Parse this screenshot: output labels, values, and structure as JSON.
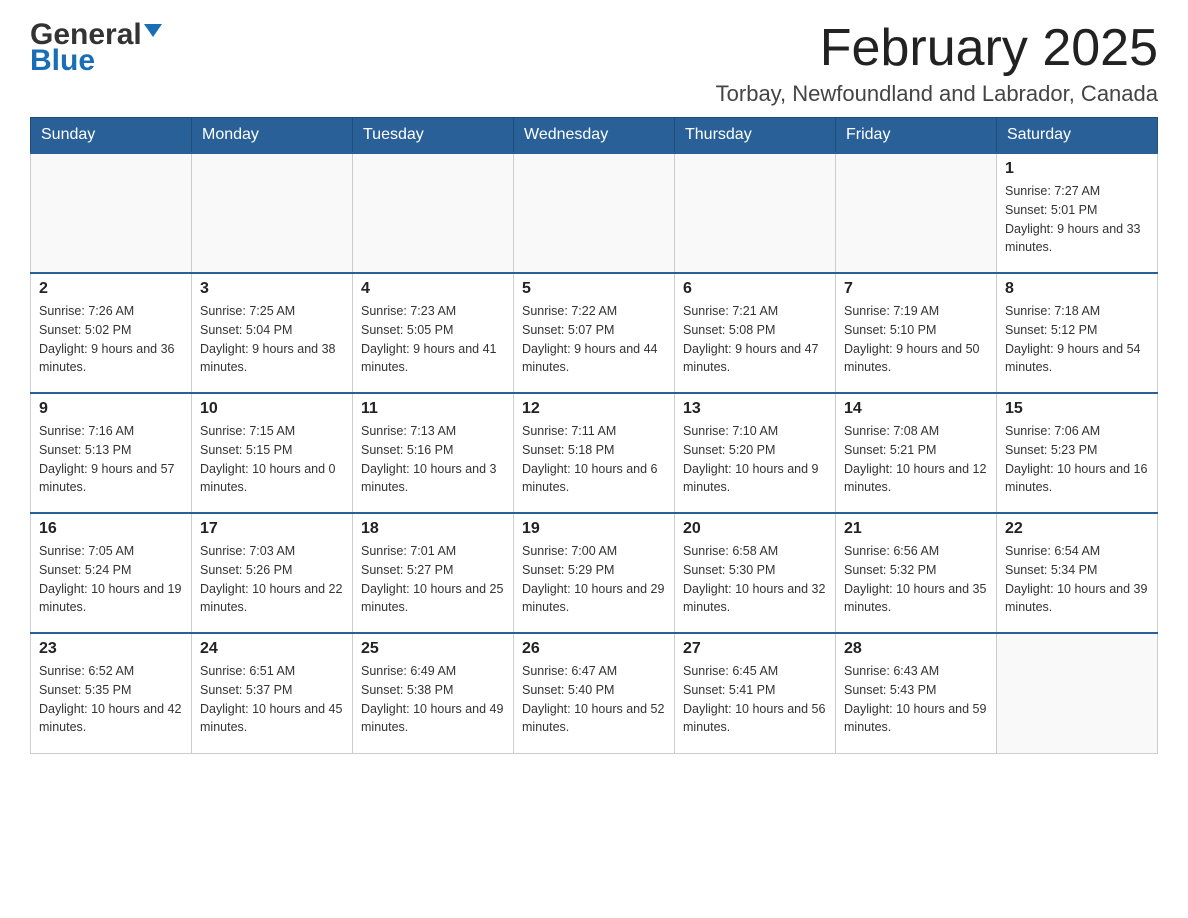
{
  "header": {
    "logo_general": "General",
    "logo_blue": "Blue",
    "month_year": "February 2025",
    "location": "Torbay, Newfoundland and Labrador, Canada"
  },
  "days_of_week": [
    "Sunday",
    "Monday",
    "Tuesday",
    "Wednesday",
    "Thursday",
    "Friday",
    "Saturday"
  ],
  "weeks": [
    {
      "days": [
        {
          "num": "",
          "info": ""
        },
        {
          "num": "",
          "info": ""
        },
        {
          "num": "",
          "info": ""
        },
        {
          "num": "",
          "info": ""
        },
        {
          "num": "",
          "info": ""
        },
        {
          "num": "",
          "info": ""
        },
        {
          "num": "1",
          "info": "Sunrise: 7:27 AM\nSunset: 5:01 PM\nDaylight: 9 hours and 33 minutes."
        }
      ]
    },
    {
      "days": [
        {
          "num": "2",
          "info": "Sunrise: 7:26 AM\nSunset: 5:02 PM\nDaylight: 9 hours and 36 minutes."
        },
        {
          "num": "3",
          "info": "Sunrise: 7:25 AM\nSunset: 5:04 PM\nDaylight: 9 hours and 38 minutes."
        },
        {
          "num": "4",
          "info": "Sunrise: 7:23 AM\nSunset: 5:05 PM\nDaylight: 9 hours and 41 minutes."
        },
        {
          "num": "5",
          "info": "Sunrise: 7:22 AM\nSunset: 5:07 PM\nDaylight: 9 hours and 44 minutes."
        },
        {
          "num": "6",
          "info": "Sunrise: 7:21 AM\nSunset: 5:08 PM\nDaylight: 9 hours and 47 minutes."
        },
        {
          "num": "7",
          "info": "Sunrise: 7:19 AM\nSunset: 5:10 PM\nDaylight: 9 hours and 50 minutes."
        },
        {
          "num": "8",
          "info": "Sunrise: 7:18 AM\nSunset: 5:12 PM\nDaylight: 9 hours and 54 minutes."
        }
      ]
    },
    {
      "days": [
        {
          "num": "9",
          "info": "Sunrise: 7:16 AM\nSunset: 5:13 PM\nDaylight: 9 hours and 57 minutes."
        },
        {
          "num": "10",
          "info": "Sunrise: 7:15 AM\nSunset: 5:15 PM\nDaylight: 10 hours and 0 minutes."
        },
        {
          "num": "11",
          "info": "Sunrise: 7:13 AM\nSunset: 5:16 PM\nDaylight: 10 hours and 3 minutes."
        },
        {
          "num": "12",
          "info": "Sunrise: 7:11 AM\nSunset: 5:18 PM\nDaylight: 10 hours and 6 minutes."
        },
        {
          "num": "13",
          "info": "Sunrise: 7:10 AM\nSunset: 5:20 PM\nDaylight: 10 hours and 9 minutes."
        },
        {
          "num": "14",
          "info": "Sunrise: 7:08 AM\nSunset: 5:21 PM\nDaylight: 10 hours and 12 minutes."
        },
        {
          "num": "15",
          "info": "Sunrise: 7:06 AM\nSunset: 5:23 PM\nDaylight: 10 hours and 16 minutes."
        }
      ]
    },
    {
      "days": [
        {
          "num": "16",
          "info": "Sunrise: 7:05 AM\nSunset: 5:24 PM\nDaylight: 10 hours and 19 minutes."
        },
        {
          "num": "17",
          "info": "Sunrise: 7:03 AM\nSunset: 5:26 PM\nDaylight: 10 hours and 22 minutes."
        },
        {
          "num": "18",
          "info": "Sunrise: 7:01 AM\nSunset: 5:27 PM\nDaylight: 10 hours and 25 minutes."
        },
        {
          "num": "19",
          "info": "Sunrise: 7:00 AM\nSunset: 5:29 PM\nDaylight: 10 hours and 29 minutes."
        },
        {
          "num": "20",
          "info": "Sunrise: 6:58 AM\nSunset: 5:30 PM\nDaylight: 10 hours and 32 minutes."
        },
        {
          "num": "21",
          "info": "Sunrise: 6:56 AM\nSunset: 5:32 PM\nDaylight: 10 hours and 35 minutes."
        },
        {
          "num": "22",
          "info": "Sunrise: 6:54 AM\nSunset: 5:34 PM\nDaylight: 10 hours and 39 minutes."
        }
      ]
    },
    {
      "days": [
        {
          "num": "23",
          "info": "Sunrise: 6:52 AM\nSunset: 5:35 PM\nDaylight: 10 hours and 42 minutes."
        },
        {
          "num": "24",
          "info": "Sunrise: 6:51 AM\nSunset: 5:37 PM\nDaylight: 10 hours and 45 minutes."
        },
        {
          "num": "25",
          "info": "Sunrise: 6:49 AM\nSunset: 5:38 PM\nDaylight: 10 hours and 49 minutes."
        },
        {
          "num": "26",
          "info": "Sunrise: 6:47 AM\nSunset: 5:40 PM\nDaylight: 10 hours and 52 minutes."
        },
        {
          "num": "27",
          "info": "Sunrise: 6:45 AM\nSunset: 5:41 PM\nDaylight: 10 hours and 56 minutes."
        },
        {
          "num": "28",
          "info": "Sunrise: 6:43 AM\nSunset: 5:43 PM\nDaylight: 10 hours and 59 minutes."
        },
        {
          "num": "",
          "info": ""
        }
      ]
    }
  ]
}
